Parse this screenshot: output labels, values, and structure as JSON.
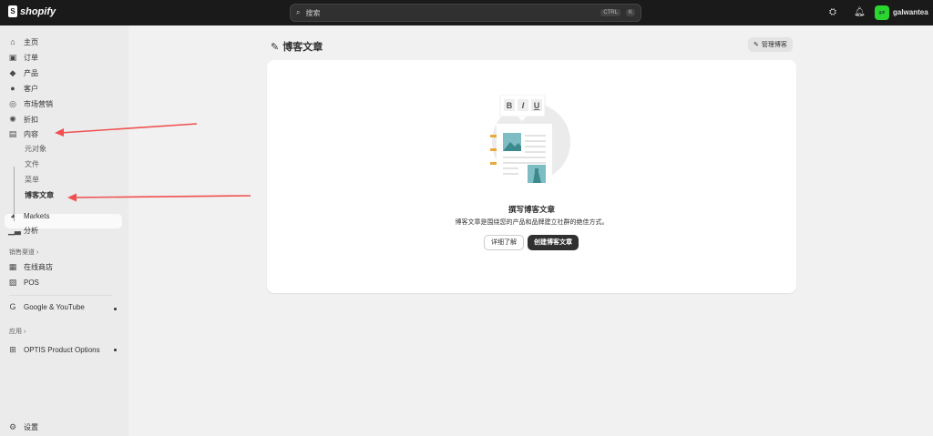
{
  "topbar": {
    "brand": "shopify",
    "search_placeholder": "搜索",
    "shortcut_ctrl": "CTRL",
    "shortcut_k": "K",
    "avatar_initials": "gal",
    "username": "galwantea"
  },
  "sidebar": {
    "items": [
      {
        "label": "主页",
        "icon": "home-icon"
      },
      {
        "label": "订单",
        "icon": "inbox-icon"
      },
      {
        "label": "产品",
        "icon": "tag-icon"
      },
      {
        "label": "客户",
        "icon": "person-icon"
      },
      {
        "label": "市场营销",
        "icon": "target-icon"
      },
      {
        "label": "折扣",
        "icon": "discount-icon"
      },
      {
        "label": "内容",
        "icon": "content-icon"
      }
    ],
    "content_sub": [
      "元对象",
      "文件",
      "菜单",
      "博客文章"
    ],
    "items2": [
      {
        "label": "Markets",
        "icon": "globe-icon"
      },
      {
        "label": "分析",
        "icon": "chart-icon"
      }
    ],
    "sales_channels_label": "销售渠道",
    "channels": [
      {
        "label": "在线商店",
        "icon": "store-icon"
      },
      {
        "label": "POS",
        "icon": "pos-icon"
      },
      {
        "label": "Google & YouTube",
        "icon": "google-icon"
      }
    ],
    "apps_label": "应用",
    "apps": [
      {
        "label": "OPTIS Product Options",
        "icon": "app-icon"
      }
    ],
    "settings": "设置"
  },
  "page": {
    "title": "博客文章",
    "manage_button": "管理博客"
  },
  "empty_state": {
    "heading": "撰写博客文章",
    "description": "博客文章是围绕您的产品和品牌建立社群的绝佳方式。",
    "learn_more": "详细了解",
    "create": "创建博客文章",
    "toolbar": [
      "B",
      "I",
      "U"
    ]
  },
  "colors": {
    "topbar": "#1a1a1a",
    "accent_green": "#2ad530",
    "annotation_arrow": "#f05050",
    "primary_button": "#303030"
  }
}
